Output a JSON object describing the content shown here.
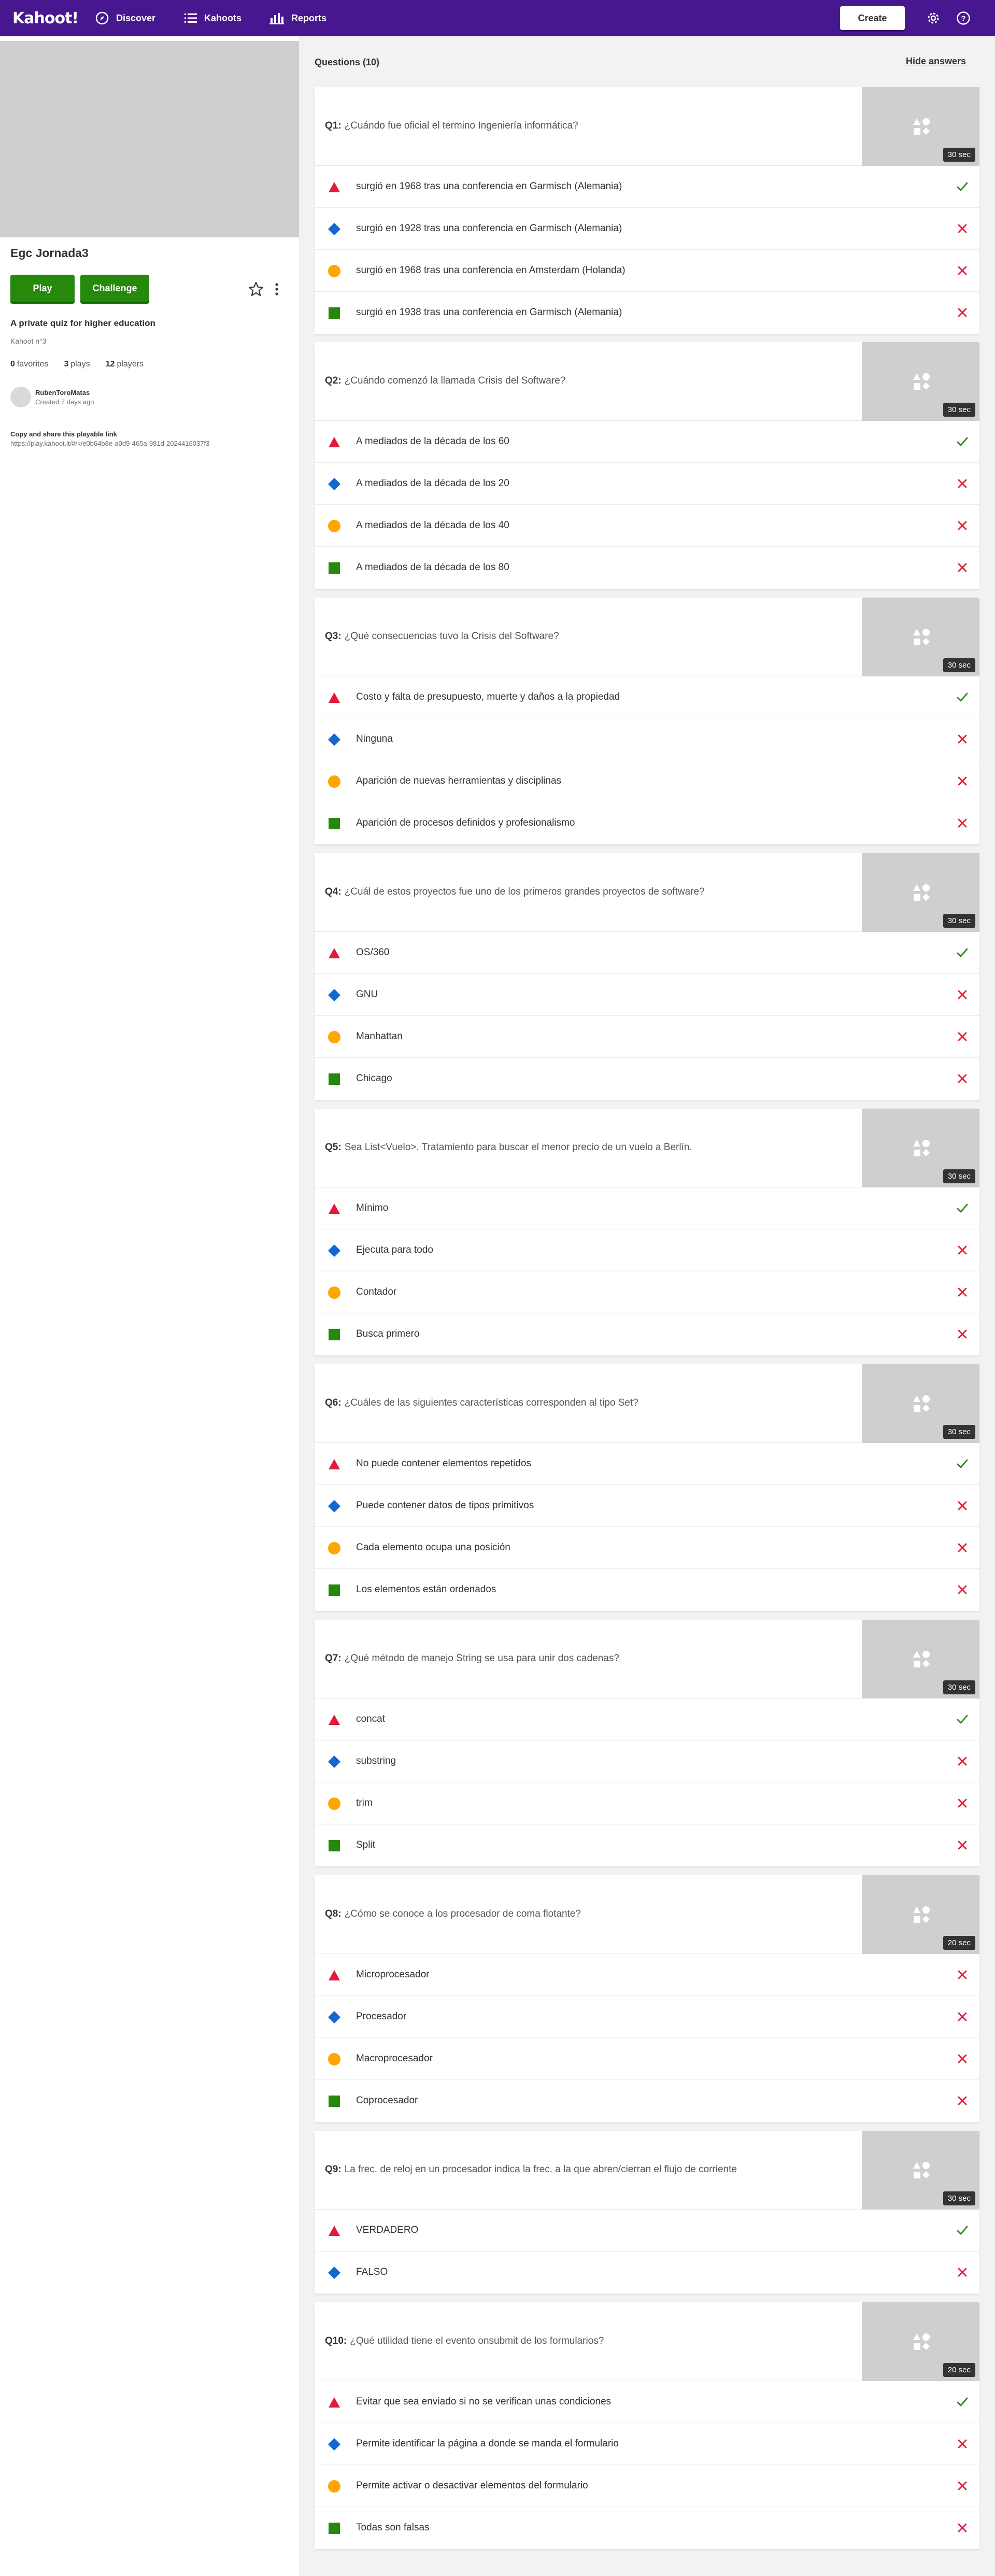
{
  "nav": {
    "logo": "Kahoot!",
    "discover": "Discover",
    "kahoots": "Kahoots",
    "reports": "Reports",
    "create": "Create"
  },
  "sidebar": {
    "title": "Egc Jornada3",
    "play": "Play",
    "challenge": "Challenge",
    "description": "A private quiz for higher education",
    "kahoot_number": "Kahoot n°3",
    "favorites_count": "0",
    "favorites_label": "favorites",
    "plays_count": "3",
    "plays_label": "plays",
    "players_count": "12",
    "players_label": "players",
    "creator": "RubenToroMatas",
    "created": "Created 7 days ago",
    "share_title": "Copy and share this playable link",
    "share_link": "https://play.kahoot.it/#/k/e0b64b8e-a0d9-465a-981d-2024416037f3"
  },
  "main": {
    "questions_header": "Questions (10)",
    "hide_answers": "Hide answers"
  },
  "colors": {
    "red": "#e21b3c",
    "blue": "#1368ce",
    "yellow": "#ffa602",
    "green": "#26890c",
    "correct": "#26890c",
    "wrong": "#e21b3c"
  },
  "questions": [
    {
      "num": "Q1:",
      "text": "¿Cuándo fue oficial el termino Ingeniería informática?",
      "time": "30 sec",
      "answers": [
        {
          "text": "surgió en 1968 tras una conferencia en Garmisch (Alemania)",
          "correct": true
        },
        {
          "text": "surgió en 1928 tras una conferencia en Garmisch (Alemania)",
          "correct": false
        },
        {
          "text": "surgió en 1968 tras una conferencia en Amsterdam (Holanda)",
          "correct": false
        },
        {
          "text": "surgió en 1938 tras una conferencia en Garmisch (Alemania)",
          "correct": false
        }
      ]
    },
    {
      "num": "Q2:",
      "text": "¿Cuándo comenzó la llamada Crisis del Software?",
      "time": "30 sec",
      "answers": [
        {
          "text": "A mediados de la década de los 60",
          "correct": true
        },
        {
          "text": "A mediados de la década de los 20",
          "correct": false
        },
        {
          "text": "A mediados de la década de los 40",
          "correct": false
        },
        {
          "text": "A mediados de la década de los 80",
          "correct": false
        }
      ]
    },
    {
      "num": "Q3:",
      "text": "¿Qué consecuencias tuvo la Crisis del Software?",
      "time": "30 sec",
      "answers": [
        {
          "text": "Costo y falta de presupuesto, muerte y daños a la propiedad",
          "correct": true
        },
        {
          "text": "Ninguna",
          "correct": false
        },
        {
          "text": "Aparición de nuevas herramientas y disciplinas",
          "correct": false
        },
        {
          "text": "Aparición de procesos definidos y profesionalismo",
          "correct": false
        }
      ]
    },
    {
      "num": "Q4:",
      "text": "¿Cuál de estos proyectos fue uno de los primeros grandes proyectos de software?",
      "time": "30 sec",
      "answers": [
        {
          "text": "OS/360",
          "correct": true
        },
        {
          "text": "GNU",
          "correct": false
        },
        {
          "text": "Manhattan",
          "correct": false
        },
        {
          "text": "Chicago",
          "correct": false
        }
      ]
    },
    {
      "num": "Q5:",
      "text": "Sea List<Vuelo>. Tratamiento para buscar el menor precio de un vuelo a Berlín.",
      "time": "30 sec",
      "answers": [
        {
          "text": "Mínimo",
          "correct": true
        },
        {
          "text": "Ejecuta para todo",
          "correct": false
        },
        {
          "text": "Contador",
          "correct": false
        },
        {
          "text": "Busca primero",
          "correct": false
        }
      ]
    },
    {
      "num": "Q6:",
      "text": "¿Cuáles de las siguientes características corresponden al tipo Set?",
      "time": "30 sec",
      "answers": [
        {
          "text": "No puede contener elementos repetidos",
          "correct": true
        },
        {
          "text": "Puede contener datos de tipos primitivos",
          "correct": false
        },
        {
          "text": "Cada elemento ocupa una posición",
          "correct": false
        },
        {
          "text": "Los elementos están ordenados",
          "correct": false
        }
      ]
    },
    {
      "num": "Q7:",
      "text": "¿Qué método de manejo String se usa para unir dos cadenas?",
      "time": "30 sec",
      "answers": [
        {
          "text": "concat",
          "correct": true
        },
        {
          "text": "substring",
          "correct": false
        },
        {
          "text": "trim",
          "correct": false
        },
        {
          "text": "Split",
          "correct": false
        }
      ]
    },
    {
      "num": "Q8:",
      "text": "¿Cómo se conoce a los procesador de coma flotante?",
      "time": "20 sec",
      "answers": [
        {
          "text": "Microprocesador",
          "correct": false
        },
        {
          "text": "Procesador",
          "correct": false
        },
        {
          "text": "Macroprocesador",
          "correct": false
        },
        {
          "text": "Coprocesador",
          "correct": false
        }
      ]
    },
    {
      "num": "Q9:",
      "text": "La frec. de reloj en un procesador indica la frec. a la que abren/cierran el flujo de corriente",
      "time": "30 sec",
      "answers": [
        {
          "text": "VERDADERO",
          "correct": true
        },
        {
          "text": "FALSO",
          "correct": false
        }
      ]
    },
    {
      "num": "Q10:",
      "text": "¿Qué utilidad tiene el evento onsubmit de los formularios?",
      "time": "20 sec",
      "answers": [
        {
          "text": "Evitar que sea enviado si no se verifican unas condiciones",
          "correct": true
        },
        {
          "text": "Permite identificar la página a donde se manda el formulario",
          "correct": false
        },
        {
          "text": "Permite activar o desactivar elementos del formulario",
          "correct": false
        },
        {
          "text": "Todas son falsas",
          "correct": false
        }
      ]
    }
  ]
}
